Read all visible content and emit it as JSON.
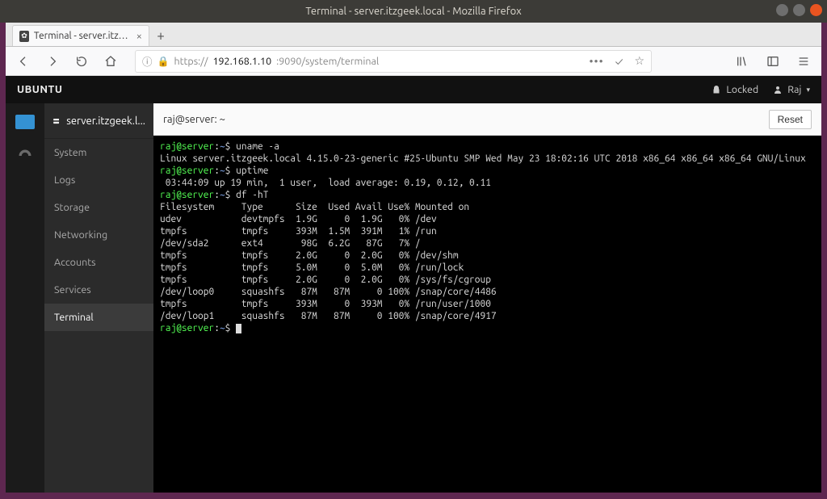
{
  "window": {
    "title": "Terminal - server.itzgeek.local - Mozilla Firefox"
  },
  "browser": {
    "tab_title": "Terminal - server.itzgeek.l",
    "url_scheme": "https://",
    "url_host": "192.168.1.10",
    "url_port_path": ":9090/system/terminal"
  },
  "header": {
    "brand": "UBUNTU",
    "locked": "Locked",
    "user": "Raj"
  },
  "sidebar": {
    "host": "server.itzgeek.l...",
    "items": [
      {
        "label": "System"
      },
      {
        "label": "Logs"
      },
      {
        "label": "Storage"
      },
      {
        "label": "Networking"
      },
      {
        "label": "Accounts"
      },
      {
        "label": "Services"
      },
      {
        "label": "Terminal"
      }
    ],
    "active": "Terminal"
  },
  "terminal": {
    "title": "raj@server: ~",
    "reset_label": "Reset",
    "prompts": {
      "userhost": "raj@server",
      "path": "~",
      "sep": ":"
    },
    "commands": {
      "c1": "uname -a",
      "c2": "uptime",
      "c3": "df -hT"
    },
    "output": {
      "uname": "Linux server.itzgeek.local 4.15.0-23-generic #25-Ubuntu SMP Wed May 23 18:02:16 UTC 2018 x86_64 x86_64 x86_64 GNU/Linux",
      "uptime": " 03:44:09 up 19 min,  1 user,  load average: 0.19, 0.12, 0.11",
      "df_header": "Filesystem     Type      Size  Used Avail Use% Mounted on",
      "df_rows": [
        "udev           devtmpfs  1.9G     0  1.9G   0% /dev",
        "tmpfs          tmpfs     393M  1.5M  391M   1% /run",
        "/dev/sda2      ext4       98G  6.2G   87G   7% /",
        "tmpfs          tmpfs     2.0G     0  2.0G   0% /dev/shm",
        "tmpfs          tmpfs     5.0M     0  5.0M   0% /run/lock",
        "tmpfs          tmpfs     2.0G     0  2.0G   0% /sys/fs/cgroup",
        "/dev/loop0     squashfs   87M   87M     0 100% /snap/core/4486",
        "tmpfs          tmpfs     393M     0  393M   0% /run/user/1000",
        "/dev/loop1     squashfs   87M   87M     0 100% /snap/core/4917"
      ]
    }
  }
}
